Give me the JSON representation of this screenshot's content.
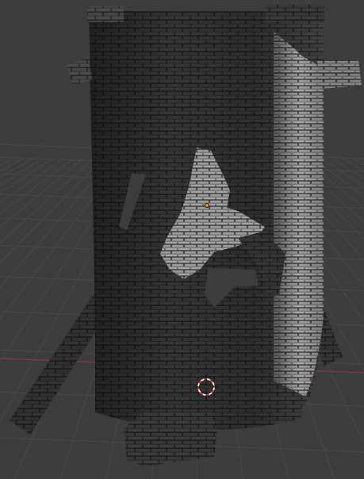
{
  "viewport": {
    "background": "#3c3c3c",
    "grid_color": "#474747",
    "x_axis_color": "#8a3a40"
  },
  "object": {
    "name": "tower",
    "material": "stone-brick",
    "base_color": "#3a3a3a",
    "mortar_color": "#1a1a1a",
    "highlight_color": "#cfcfcf"
  },
  "origin_dot": {
    "color": "#ff8a00"
  },
  "cursor_3d": {
    "icon": "crosshair-cursor-icon",
    "ring_colors": [
      "#e04040",
      "#ffffff"
    ]
  }
}
